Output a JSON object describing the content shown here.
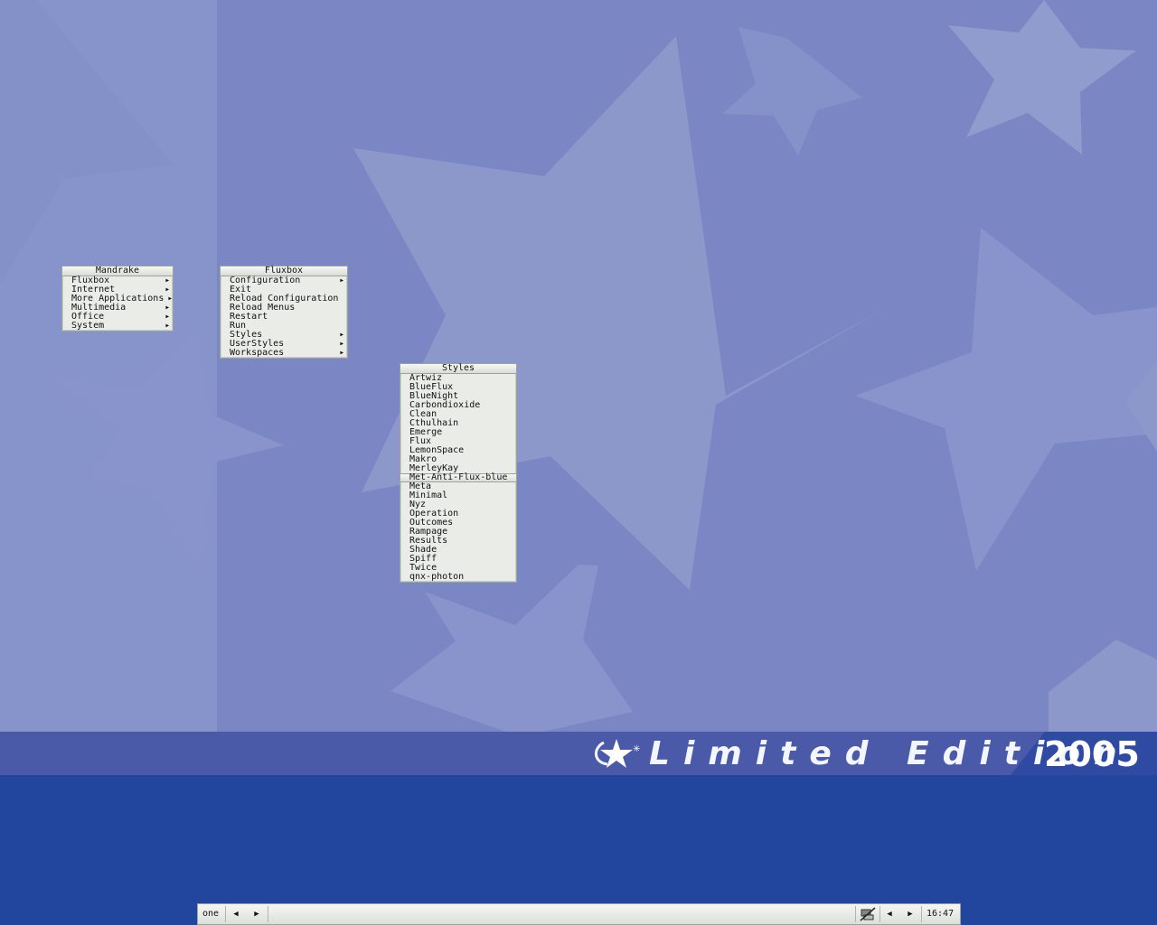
{
  "wallpaper": {
    "brand_text": "Limited Edition",
    "brand_year": "2005",
    "colors": {
      "sky": "#7b87c4",
      "band": "#4a5aa8",
      "lower": "#22459d"
    }
  },
  "menus": {
    "mandrake": {
      "title": "Mandrake",
      "items": [
        {
          "label": "Fluxbox",
          "submenu": true
        },
        {
          "label": "Internet",
          "submenu": true
        },
        {
          "label": "More Applications",
          "submenu": true
        },
        {
          "label": "Multimedia",
          "submenu": true
        },
        {
          "label": "Office",
          "submenu": true
        },
        {
          "label": "System",
          "submenu": true
        }
      ]
    },
    "fluxbox": {
      "title": "Fluxbox",
      "items": [
        {
          "label": "Configuration",
          "submenu": true
        },
        {
          "label": "Exit",
          "submenu": false
        },
        {
          "label": "Reload Configuration",
          "submenu": false
        },
        {
          "label": "Reload Menus",
          "submenu": false
        },
        {
          "label": "Restart",
          "submenu": false
        },
        {
          "label": "Run",
          "submenu": false
        },
        {
          "label": "Styles",
          "submenu": true
        },
        {
          "label": "UserStyles",
          "submenu": true
        },
        {
          "label": "Workspaces",
          "submenu": true
        }
      ]
    },
    "styles": {
      "title": "Styles",
      "selected": "Met-Anti-Flux-blue",
      "items": [
        "Artwiz",
        "BlueFlux",
        "BlueNight",
        "Carbondioxide",
        "Clean",
        "Cthulhain",
        "Emerge",
        "Flux",
        "LemonSpace",
        "Makro",
        "MerleyKay",
        "Met-Anti-Flux-blue",
        "Meta",
        "Minimal",
        "Nyz",
        "Operation",
        "Outcomes",
        "Rampage",
        "Results",
        "Shade",
        "Spiff",
        "Twice",
        "qnx-photon"
      ]
    }
  },
  "toolbar": {
    "workspace_name": "one",
    "prev_workspace_glyph": "◀",
    "next_workspace_glyph": "▶",
    "prev_window_glyph": "◀",
    "next_window_glyph": "▶",
    "tray_icon": "network-icon",
    "clock": "16:47"
  }
}
